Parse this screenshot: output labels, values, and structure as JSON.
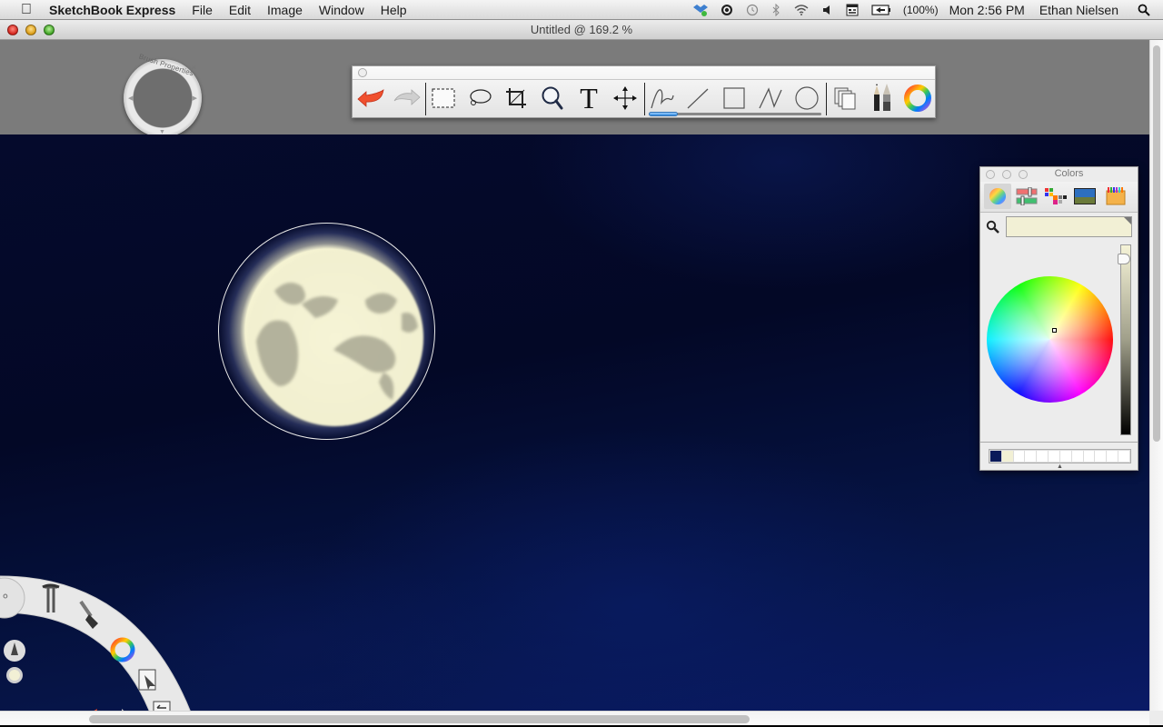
{
  "menubar": {
    "apple_icon": "apple-logo",
    "app_name": "SketchBook Express",
    "items": [
      "File",
      "Edit",
      "Image",
      "Window",
      "Help"
    ],
    "status_icons": [
      "dropbox-icon",
      "growl-icon",
      "time-machine-icon",
      "bluetooth-icon",
      "wifi-icon",
      "volume-icon",
      "menu-extra-icon",
      "battery-icon"
    ],
    "battery": "(100%)",
    "clock": "Mon 2:56 PM",
    "user": "Ethan Nielsen",
    "spotlight_icon": "spotlight-search-icon"
  },
  "window": {
    "title": "Untitled @ 169.2 %",
    "zoom_level": "169.2 %"
  },
  "brush_puck": {
    "label": "Brush Properties",
    "color": "#6e6e6e"
  },
  "toolbar": {
    "tools": [
      {
        "name": "undo",
        "icon": "undo-icon"
      },
      {
        "name": "redo",
        "icon": "redo-icon"
      },
      {
        "name": "rectangle-select",
        "icon": "marquee-select-icon"
      },
      {
        "name": "lasso-select",
        "icon": "lasso-icon"
      },
      {
        "name": "crop",
        "icon": "crop-icon"
      },
      {
        "name": "zoom",
        "icon": "magnifier-icon"
      },
      {
        "name": "text",
        "icon": "text-icon",
        "glyph": "T"
      },
      {
        "name": "move",
        "icon": "move-icon"
      },
      {
        "name": "freehand",
        "icon": "freehand-stroke-icon"
      },
      {
        "name": "line",
        "icon": "line-icon"
      },
      {
        "name": "rectangle",
        "icon": "rectangle-icon"
      },
      {
        "name": "polyline",
        "icon": "polyline-icon"
      },
      {
        "name": "ellipse",
        "icon": "ellipse-icon"
      },
      {
        "name": "layers",
        "icon": "layers-icon"
      },
      {
        "name": "brushes",
        "icon": "brushes-icon"
      },
      {
        "name": "color",
        "icon": "color-wheel-icon"
      }
    ],
    "active_stroke_tool": "freehand"
  },
  "canvas": {
    "background_color": "#050a2c",
    "moon_color": "#f2f0d5"
  },
  "lagoon": {
    "items": [
      "lasso-menu-icon",
      "tools-icon",
      "brush-icon",
      "color-wheel-icon",
      "cursor-icon",
      "layers-swap-icon"
    ],
    "undo_icon": "undo-icon",
    "redo_icon": "redo-icon",
    "current_brush_icon": "pencil-brush-icon",
    "current_color": "#f2f0d5"
  },
  "colors_panel": {
    "title": "Colors",
    "tabs": [
      "color-wheel-tab",
      "color-sliders-tab",
      "color-palettes-tab",
      "image-palettes-tab",
      "crayons-tab"
    ],
    "active_tab": "color-wheel-tab",
    "current_color": "#f2f0d5",
    "brightness": 0.95,
    "swatches": [
      "#0a1a5a",
      "#f2f0d5",
      "",
      "",
      "",
      "",
      "",
      "",
      "",
      "",
      "",
      ""
    ]
  },
  "scrollbars": {
    "horizontal_position": 0.08,
    "vertical_position": 0.0
  }
}
